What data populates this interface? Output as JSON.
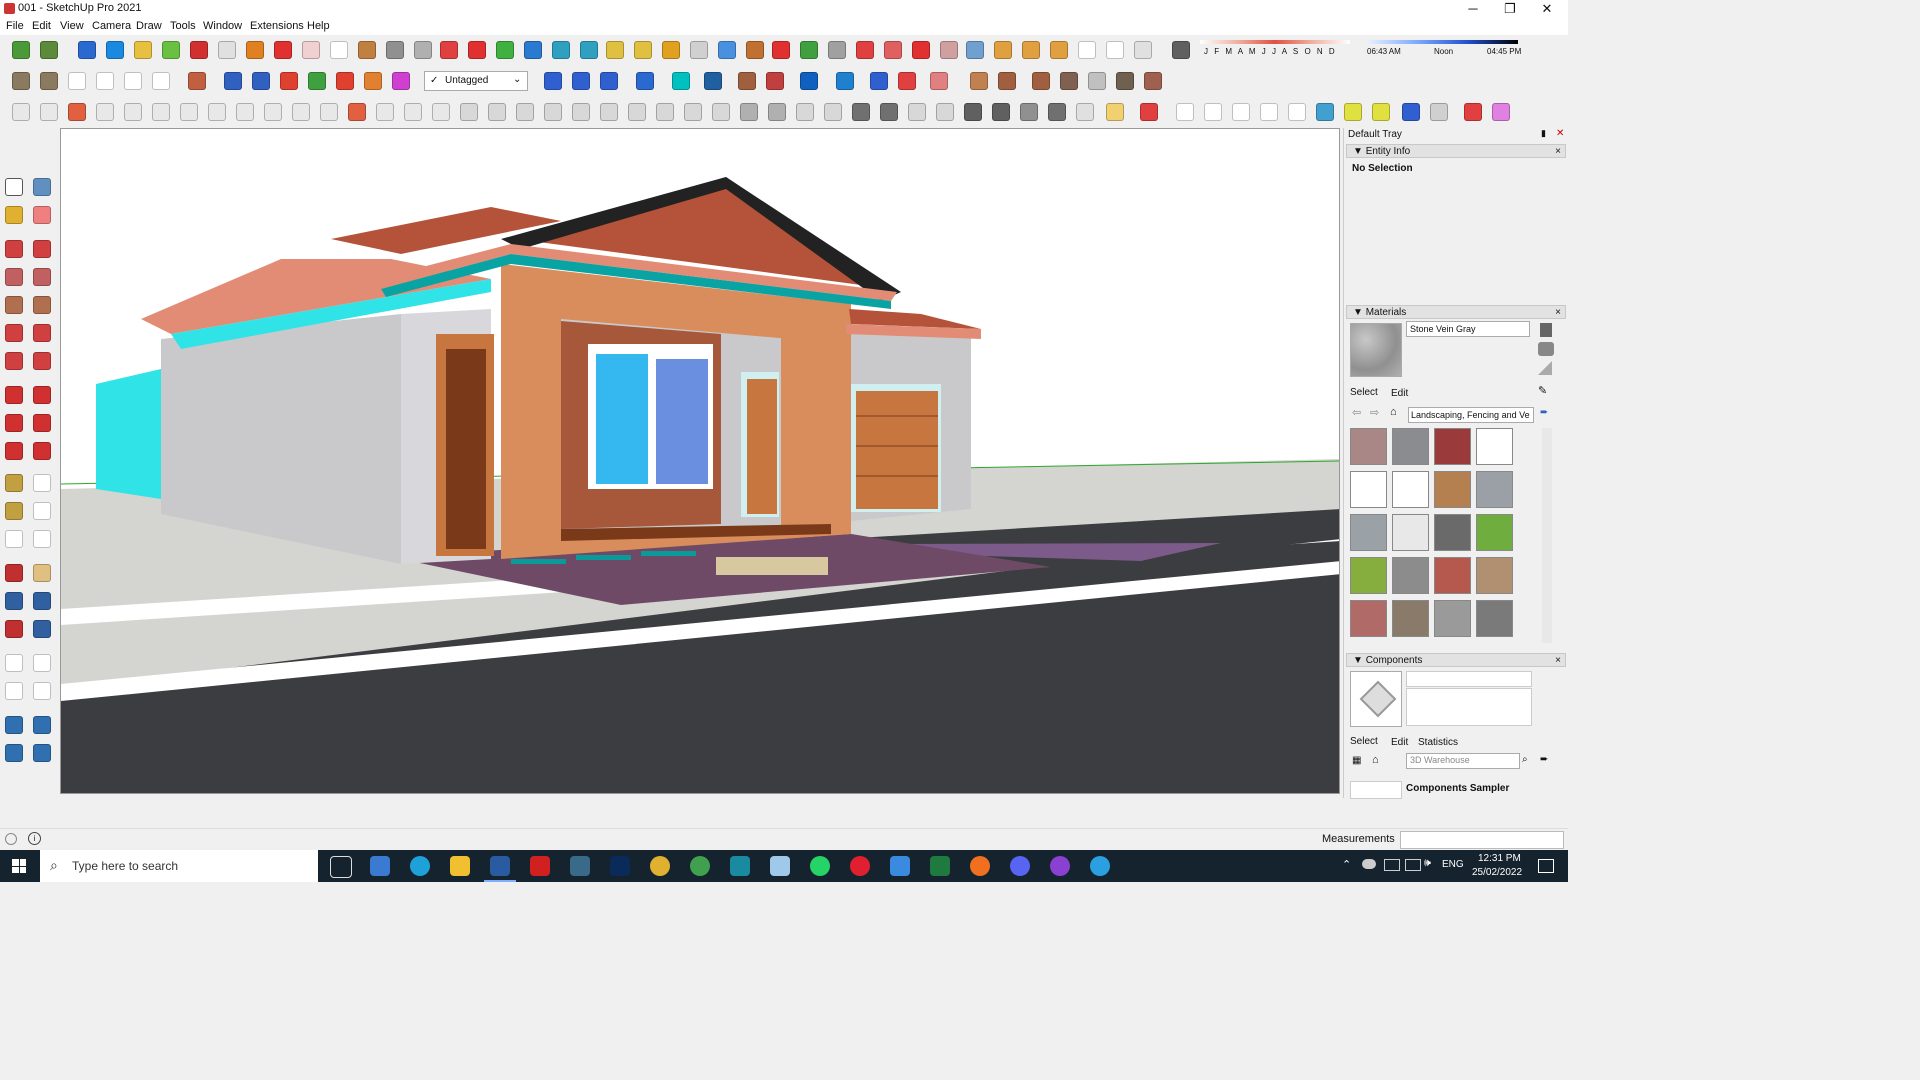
{
  "window": {
    "title": "001 - SketchUp Pro 2021",
    "minimize_glyph": "─",
    "restore_glyph": "❐",
    "close_glyph": "✕"
  },
  "menu": [
    "File",
    "Edit",
    "View",
    "Camera",
    "Draw",
    "Tools",
    "Window",
    "Extensions",
    "Help"
  ],
  "toolbar": {
    "tag_selector": "Untagged",
    "shadow_months": "J F M A M J J A S O N D",
    "time_start": "06:43 AM",
    "time_mid": "Noon",
    "time_end": "04:45 PM"
  },
  "tray": {
    "title": "Default Tray",
    "entity_info": {
      "header": "Entity Info",
      "selection": "No Selection"
    },
    "materials": {
      "header": "Materials",
      "current_name": "Stone Vein Gray",
      "tab_select": "Select",
      "tab_edit": "Edit",
      "library": "Landscaping, Fencing and Ve",
      "swatch_colors": [
        "#a98786",
        "#8a8c90",
        "#9a3a3a",
        "#ffffff",
        "#ffffff",
        "#ffffff",
        "#b48050",
        "#9aa0a6",
        "#9aa2a8",
        "#e8e8e8",
        "#6a6a6a",
        "#6fae3e",
        "#86ae3e",
        "#8c8c8c",
        "#b5584e",
        "#b09070",
        "#b06a68",
        "#8a7a6a",
        "#9a9a9a",
        "#7a7a7a"
      ]
    },
    "components": {
      "header": "Components",
      "tab_select": "Select",
      "tab_edit": "Edit",
      "tab_statistics": "Statistics",
      "search_placeholder": "3D Warehouse",
      "sampler": "Components Sampler"
    }
  },
  "status": {
    "measurements_label": "Measurements"
  },
  "taskbar": {
    "search_placeholder": "Type here to search",
    "language": "ENG",
    "time": "12:31 PM",
    "date": "25/02/2022"
  }
}
